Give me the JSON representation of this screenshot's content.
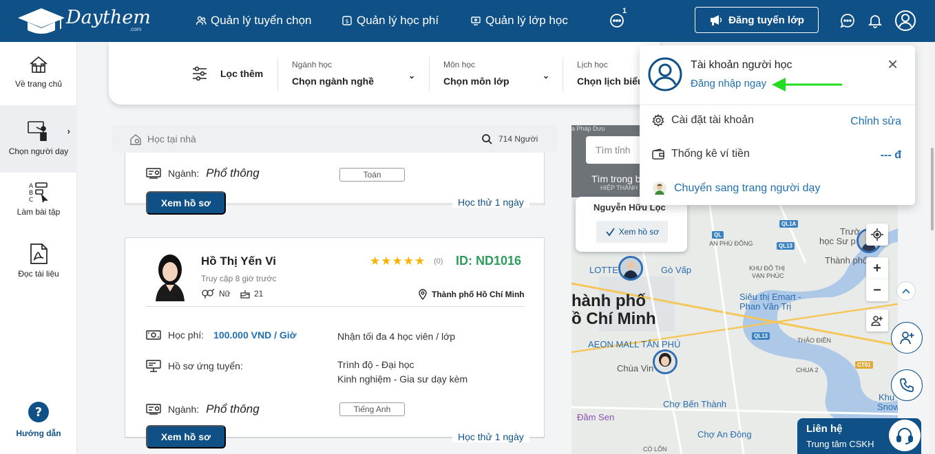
{
  "header": {
    "logo_text": "Daythem",
    "logo_sub": ".com",
    "nav": [
      {
        "label": "Quản lý tuyển chọn",
        "icon": "people-icon"
      },
      {
        "label": "Quản lý học phí",
        "icon": "money-icon"
      },
      {
        "label": "Quản lý lớp học",
        "icon": "classroom-icon"
      }
    ],
    "more_badge": "1",
    "post_button": "Đăng tuyển lớp"
  },
  "sidebar": {
    "items": [
      {
        "label": "Về trang chủ",
        "icon": "home-icon"
      },
      {
        "label": "Chọn người dạy",
        "icon": "teacher-board-icon"
      },
      {
        "label": "Làm bài tập",
        "icon": "exercise-icon"
      },
      {
        "label": "Đọc tài liệu",
        "icon": "pdf-icon"
      }
    ],
    "guide_label": "Hướng dẫn"
  },
  "filters": {
    "button_label": "Lọc thêm",
    "selects": [
      {
        "label": "Ngành học",
        "value": "Chọn ngành nghề"
      },
      {
        "label": "Môn học",
        "value": "Chọn môn lớp"
      },
      {
        "label": "Lịch học",
        "value": "Chọn lịch biểu"
      }
    ]
  },
  "search": {
    "placeholder": "Học tại nhà",
    "count": "714 Người"
  },
  "card_top": {
    "major_label": "Ngành:",
    "major_value": "Phổ thông",
    "subject_tag": "Toán",
    "view_button": "Xem hồ sơ",
    "trial": "Học thử 1 ngày"
  },
  "card_main": {
    "name": "Hồ Thị Yến Vi",
    "stars": "★★★★★",
    "rating_count": "(0)",
    "id": "ID: ND1016",
    "last_access": "Truy cập 8 giờ trước",
    "gender": "Nữ",
    "age": "21",
    "location": "Thành phố Hồ Chí Minh",
    "fee_label": "Học phí:",
    "fee_value": "100.000 VND / Giờ",
    "capacity": "Nhận tối đa 4 học viên / lớp",
    "profile_label": "Hồ sơ ứng tuyển:",
    "level": "Trình độ - Đại học",
    "experience": "Kinh nghiệm - Gia sư dạy kèm",
    "major_label": "Ngành:",
    "major_value": "Phổ thông",
    "subject_tag": "Tiếng Anh",
    "view_button": "Xem hồ sơ",
    "trial": "Học thử 1 ngày"
  },
  "map": {
    "search_placeholder": "Tìm tỉnh",
    "search_hint": "Tìm trong b",
    "popup_name": "Nguyễn Hữu Lộc",
    "popup_button": "Xem hồ sơ",
    "labels": {
      "lotte": "LOTTE",
      "govap": "Gò Vấp",
      "city1": "hành phố",
      "city2": "ồ Chí Minh",
      "aeon": "AEON MALL TÂN PHÚ",
      "emart1": "Siêu thị Emart -",
      "emart2": "Phan Văn Trị",
      "truong1": "Trườ",
      "truong2": "học Sư p",
      "truong3": "Thành phố",
      "chuavinh": "Chùa Vin",
      "chobenthanh": "Chợ Bến Thành",
      "damsen": "Đầm Sen",
      "choandong": "Chợ An Đông",
      "khu1": "Khu",
      "khu2": "Snow",
      "anphudong": "AN PHÚ ĐÔNG",
      "khudi": "KHU ĐÔ THỊ",
      "vanphuc": "VẠN PHÚC",
      "thaodien": "THẢO ĐIỀN",
      "chua2": "CHUA 2",
      "colon": "CÒ LÔN",
      "hiepthanh": "HIỆP THÀNH",
      "phapduu": "a Pháp Dưu",
      "ql1a": "QL1A",
      "ql": "QL",
      "ql13a": "QL13",
      "ql13b": "QL13",
      "ct01": "CT01"
    }
  },
  "account_menu": {
    "title": "Tài khoản người học",
    "login_link": "Đăng nhập ngay",
    "settings_label": "Cài đặt tài khoản",
    "settings_action": "Chỉnh sửa",
    "wallet_label": "Thống kê ví tiền",
    "wallet_value": "--- đ",
    "switch_label": "Chuyển sang trang người dạy"
  },
  "contact": {
    "title": "Liên hệ",
    "subtitle": "Trung tâm CSKH"
  },
  "colors": {
    "primary": "#0f5186",
    "accent_green": "#2e9c5a",
    "star": "#f4b400",
    "arrow": "#22dd22"
  }
}
